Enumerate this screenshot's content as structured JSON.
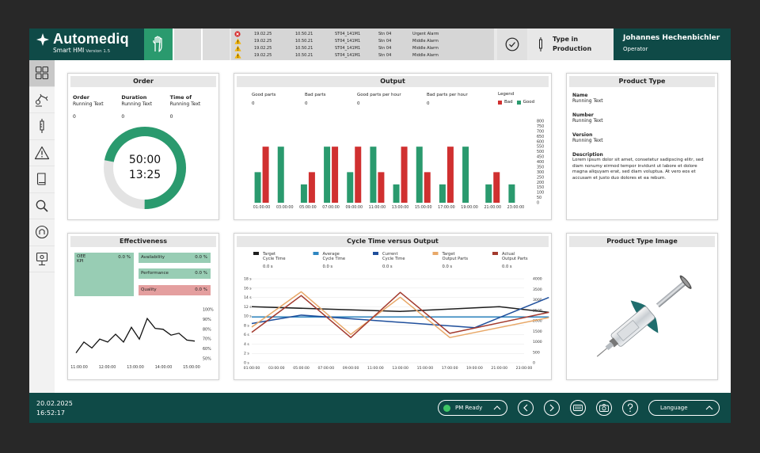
{
  "brand": {
    "name": "Automediq",
    "subtitle": "Smart HMI",
    "version": "Version 1.5"
  },
  "alarms": [
    {
      "severity": "error",
      "date": "19.02.25",
      "time": "10.50.21",
      "code": "ST04_141M1",
      "station": "Stn 04",
      "message": "Urgent Alarm"
    },
    {
      "severity": "warning",
      "date": "19.02.25",
      "time": "10.50.21",
      "code": "ST04_141M1",
      "station": "Stn 04",
      "message": "Middle Alarm"
    },
    {
      "severity": "warning",
      "date": "19.02.25",
      "time": "10.50.21",
      "code": "ST04_141M1",
      "station": "Stn 04",
      "message": "Middle Alarm"
    },
    {
      "severity": "warning",
      "date": "19.02.25",
      "time": "10.50.21",
      "code": "ST04_141M1",
      "station": "Stn 04",
      "message": "Middle Alarm"
    }
  ],
  "status": {
    "type_line1": "Type in",
    "type_line2": "Production"
  },
  "user": {
    "name": "Johannes Hechenbichler",
    "role": "Operator"
  },
  "sidebar": {
    "items": [
      {
        "name": "dashboard-icon"
      },
      {
        "name": "robot-arm-icon"
      },
      {
        "name": "syringe-icon"
      },
      {
        "name": "warning-icon"
      },
      {
        "name": "book-icon"
      },
      {
        "name": "search-icon"
      },
      {
        "name": "support-icon"
      },
      {
        "name": "settings-monitor-icon"
      }
    ]
  },
  "order": {
    "title": "Order",
    "fields": [
      {
        "label": "Order",
        "sub": "Running Text",
        "value": "0"
      },
      {
        "label": "Duration",
        "sub": "Running Text",
        "value": "0"
      },
      {
        "label": "Time of",
        "sub": "Running Text",
        "value": "0"
      }
    ],
    "duration_display": "50:00",
    "time_display": "13:25",
    "progress": 0.72
  },
  "output": {
    "title": "Output",
    "metrics": [
      {
        "label": "Good parts",
        "value": "0"
      },
      {
        "label": "Bad parts",
        "value": "0"
      },
      {
        "label": "Good parts per hour",
        "value": "0"
      },
      {
        "label": "Bad parts per hour",
        "value": "0"
      }
    ],
    "legend_title": "Legend",
    "legend_bad": "Bad",
    "legend_good": "Good"
  },
  "product_type": {
    "title": "Product Type",
    "name_label": "Name",
    "name_value": "Running Text",
    "number_label": "Number",
    "number_value": "Running Text",
    "version_label": "Version",
    "version_value": "Running Text",
    "description_label": "Description",
    "description_text": "Lorem ipsum dolor sit amet, consetetur sadipscing elitr, sed diam nonumy eirmod tempor invidunt ut labore et dolore magna aliquyam erat, sed diam voluptua. At vero eos et accusam et justo duo dolores et ea rebum."
  },
  "effectiveness": {
    "title": "Effectiveness",
    "oee_label": "OEE",
    "oee_sub": "KPI",
    "oee_value": "0.0 %",
    "availability_label": "Availability",
    "availability_value": "0.0 %",
    "performance_label": "Performance",
    "performance_value": "0.0 %",
    "quality_label": "Quality",
    "quality_value": "0.0 %"
  },
  "cycle": {
    "title": "Cycle Time versus Output",
    "legend": [
      {
        "line1": "Target",
        "line2": "Cycle Time",
        "value": "0.0 s",
        "color": "#1e1e1e"
      },
      {
        "line1": "Average",
        "line2": "Cycle Time",
        "value": "0.0 s",
        "color": "#2e86c1"
      },
      {
        "line1": "Current",
        "line2": "Cycle Time",
        "value": "0.0 s",
        "color": "#1f4f9c"
      },
      {
        "line1": "Target",
        "line2": "Output Parts",
        "value": "0.0 s",
        "color": "#e8a868"
      },
      {
        "line1": "Actual",
        "line2": "Output Parts",
        "value": "0.0 s",
        "color": "#a33a2e"
      }
    ]
  },
  "image_panel": {
    "title": "Product Type Image"
  },
  "bottom": {
    "date": "20.02.2025",
    "time": "16:52:17",
    "pm_status": "PM Ready",
    "language": "Language"
  },
  "colors": {
    "brand": "#0f4a47",
    "good": "#2a9a6e",
    "bad": "#d03030",
    "accent_green": "#3ec766"
  },
  "chart_data": [
    {
      "type": "bar",
      "title": "Output",
      "categories": [
        "01:00:00",
        "03:00:00",
        "05:00:00",
        "07:00:00",
        "09:00:00",
        "11:00:00",
        "13:00:00",
        "15:00:00",
        "17:00:00",
        "19:00:00",
        "21:00:00",
        "23:00:00"
      ],
      "series": [
        {
          "name": "Bad",
          "color": "#d03030",
          "values": [
            550,
            0,
            300,
            550,
            550,
            300,
            550,
            300,
            550,
            0,
            300,
            0
          ]
        },
        {
          "name": "Good",
          "color": "#2a9a6e",
          "values": [
            300,
            550,
            180,
            550,
            300,
            550,
            180,
            550,
            180,
            550,
            180,
            180
          ]
        }
      ],
      "yticks": [
        "0",
        "50",
        "100",
        "150",
        "200",
        "250",
        "300",
        "350",
        "400",
        "450",
        "500",
        "550",
        "600",
        "650",
        "700",
        "750",
        "800"
      ],
      "ylim": [
        0,
        800
      ],
      "grid": false
    },
    {
      "type": "line",
      "title": "Effectiveness",
      "x": [
        "11:00:00",
        "12:00:00",
        "13:00:00",
        "14:00:00",
        "15:00:00"
      ],
      "values": [
        56,
        67,
        61,
        70,
        67,
        75,
        67,
        82,
        70,
        91,
        81,
        80,
        74,
        76,
        69,
        68
      ],
      "yticks": [
        "100%",
        "90%",
        "80%",
        "70%",
        "60%",
        "50%"
      ],
      "ylim": [
        50,
        100
      ]
    },
    {
      "type": "line",
      "title": "Cycle Time versus Output",
      "x": [
        "01:00:00",
        "03:00:00",
        "05:00:00",
        "07:00:00",
        "09:00:00",
        "11:00:00",
        "13:00:00",
        "15:00:00",
        "17:00:00",
        "19:00:00",
        "21:00:00",
        "23:00:00"
      ],
      "y_left_ticks": [
        "18 s",
        "16 s",
        "14 s",
        "12 s",
        "10 s",
        "8 s",
        "6 s",
        "4 s",
        "2 s",
        "0 s"
      ],
      "y_right_ticks": [
        "4000",
        "3500",
        "3000",
        "2500",
        "2000",
        "1500",
        "1000",
        "500",
        "0"
      ],
      "ylim_left": [
        0,
        18
      ],
      "ylim_right": [
        0,
        4000
      ],
      "series": [
        {
          "name": "Target Cycle Time",
          "color": "#1e1e1e",
          "axis": "left",
          "points": [
            [
              0,
              12
            ],
            [
              6,
              11
            ],
            [
              10,
              12
            ],
            [
              12,
              10.8
            ]
          ]
        },
        {
          "name": "Average Cycle Time",
          "color": "#2e86c1",
          "axis": "left",
          "points": [
            [
              0,
              9.8
            ],
            [
              12,
              9.8
            ]
          ]
        },
        {
          "name": "Current Cycle Time",
          "color": "#1f4f9c",
          "axis": "left",
          "points": [
            [
              0,
              8.4
            ],
            [
              2,
              10.2
            ],
            [
              9,
              7.5
            ],
            [
              12,
              14
            ]
          ]
        },
        {
          "name": "Target Output Parts",
          "color": "#e8a868",
          "axis": "right",
          "points": [
            [
              0,
              1700
            ],
            [
              2,
              3380
            ],
            [
              4,
              1350
            ],
            [
              6,
              3120
            ],
            [
              8,
              1200
            ],
            [
              12,
              2150
            ]
          ]
        },
        {
          "name": "Actual Output Parts",
          "color": "#a33a2e",
          "axis": "right",
          "points": [
            [
              0,
              1450
            ],
            [
              2,
              3200
            ],
            [
              4,
              1200
            ],
            [
              6,
              3350
            ],
            [
              8,
              1400
            ],
            [
              12,
              2400
            ]
          ]
        }
      ]
    }
  ]
}
